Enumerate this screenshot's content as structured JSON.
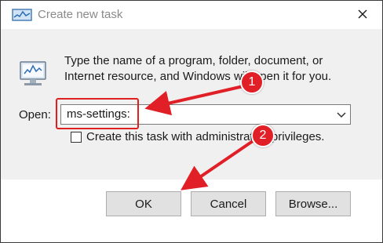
{
  "window": {
    "title": "Create new task"
  },
  "dialog": {
    "description_line1": "Type the name of a program, folder, document, or",
    "description_line2": "Internet resource, and Windows will open it for you.",
    "open_label": "Open:",
    "open_value": "ms-settings:",
    "checkbox_label": "Create this task with administrative privileges.",
    "checkbox_checked": false
  },
  "buttons": {
    "ok": "OK",
    "cancel": "Cancel",
    "browse": "Browse..."
  },
  "annotations": {
    "badge1": "1",
    "badge2": "2",
    "color": "#e11f26"
  },
  "icons": {
    "app": "task-manager-icon",
    "program": "run-program-icon",
    "close": "close-icon",
    "dropdown": "chevron-down-icon"
  }
}
